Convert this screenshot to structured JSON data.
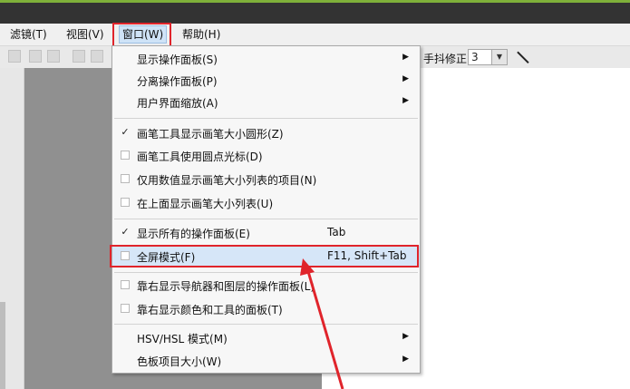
{
  "menubar": {
    "items": [
      {
        "label": "滤镜(T)"
      },
      {
        "label": "视图(V)"
      },
      {
        "label": "窗口(W)"
      },
      {
        "label": "帮助(H)"
      }
    ]
  },
  "toolbar": {
    "stabilizer_label": "手抖修正",
    "stabilizer_value": "3"
  },
  "window_menu": {
    "items": [
      {
        "label": "显示操作面板(S)"
      },
      {
        "label": "分离操作面板(P)"
      },
      {
        "label": "用户界面缩放(A)"
      },
      {
        "label": "画笔工具显示画笔大小圆形(Z)",
        "checked": true
      },
      {
        "label": "画笔工具使用圆点光标(D)",
        "checked": false
      },
      {
        "label": "仅用数值显示画笔大小列表的项目(N)",
        "checked": false
      },
      {
        "label": "在上面显示画笔大小列表(U)",
        "checked": false
      },
      {
        "label": "显示所有的操作面板(E)",
        "checked": true,
        "shortcut": "Tab"
      },
      {
        "label": "全屏模式(F)",
        "checked": false,
        "shortcut": "F11, Shift+Tab"
      },
      {
        "label": "靠右显示导航器和图层的操作面板(L)",
        "checked": false
      },
      {
        "label": "靠右显示颜色和工具的面板(T)",
        "checked": false
      },
      {
        "label": "HSV/HSL 模式(M)"
      },
      {
        "label": "色板项目大小(W)"
      }
    ]
  },
  "colors": {
    "highlight": "#e0242b",
    "title_accent": "#7fb03a"
  }
}
